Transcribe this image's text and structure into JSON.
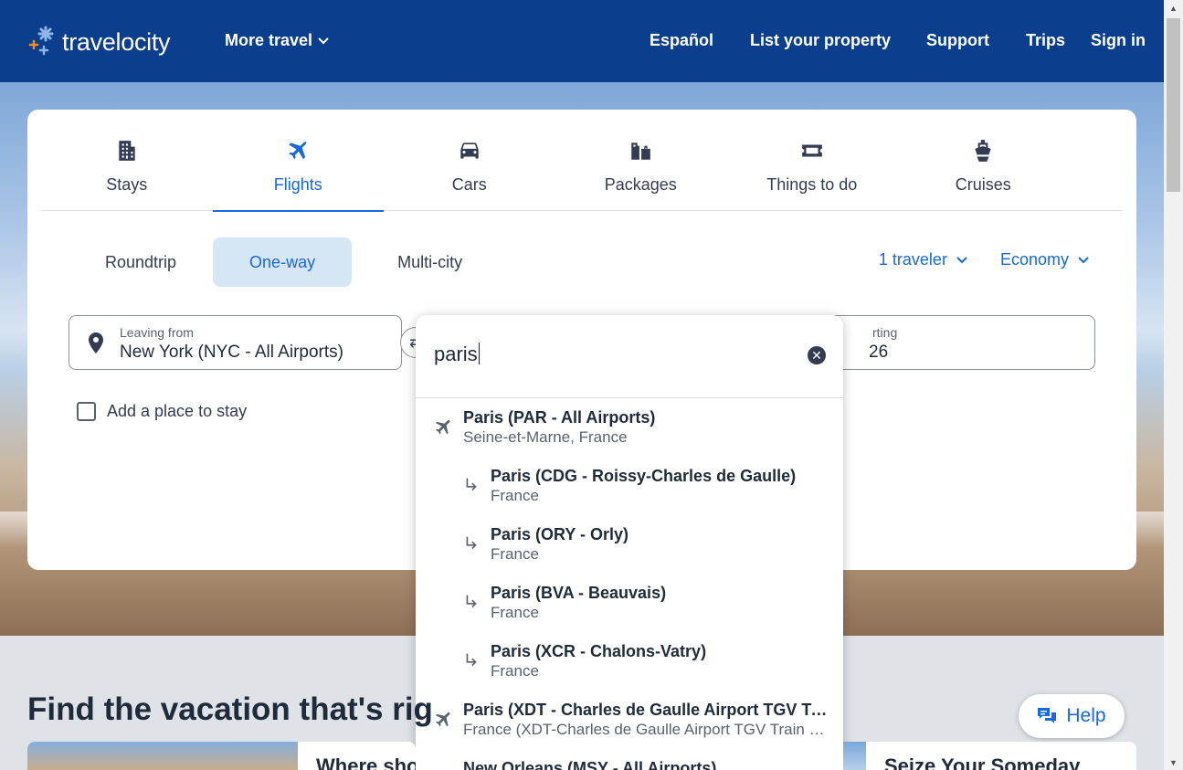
{
  "header": {
    "logo_text": "travelocity",
    "more_travel": "More travel",
    "nav": [
      "Español",
      "List your property",
      "Support",
      "Trips",
      "Sign in"
    ]
  },
  "tabs": [
    {
      "label": "Stays",
      "icon": "building-icon"
    },
    {
      "label": "Flights",
      "icon": "plane-icon",
      "active": true
    },
    {
      "label": "Cars",
      "icon": "car-icon"
    },
    {
      "label": "Packages",
      "icon": "luggage-icon"
    },
    {
      "label": "Things to do",
      "icon": "ticket-icon"
    },
    {
      "label": "Cruises",
      "icon": "ship-icon"
    }
  ],
  "trip_types": [
    "Roundtrip",
    "One-way",
    "Multi-city"
  ],
  "travelers": "1 traveler",
  "cabin": "Economy",
  "leaving_from": {
    "label": "Leaving from",
    "value": "New York (NYC - All Airports)"
  },
  "date_field": {
    "label": "rting",
    "value": "26"
  },
  "add_stay": "Add a place to stay",
  "dropdown": {
    "query": "paris",
    "results": [
      {
        "title": "Paris (PAR - All Airports)",
        "sub": "Seine-et-Marne, France",
        "kind": "main"
      },
      {
        "title": "Paris (CDG - Roissy-Charles de Gaulle)",
        "sub": "France",
        "kind": "sub"
      },
      {
        "title": "Paris (ORY - Orly)",
        "sub": "France",
        "kind": "sub"
      },
      {
        "title": "Paris (BVA - Beauvais)",
        "sub": "France",
        "kind": "sub"
      },
      {
        "title": "Paris (XCR - Chalons-Vatry)",
        "sub": "France",
        "kind": "sub"
      },
      {
        "title": "Paris (XDT - Charles de Gaulle Airport TGV Train Station)",
        "sub": "France (XDT-Charles de Gaulle Airport TGV Train Station)",
        "kind": "main"
      },
      {
        "title": "New Orleans (MSY - All Airports)",
        "sub": "",
        "kind": "main"
      }
    ]
  },
  "find_heading": "Find the vacation that's rig",
  "promo_left": "Where sho",
  "promo_right": "Seize Your Someday",
  "help": "Help",
  "colors": {
    "header": "#0b3f8e",
    "accent": "#1668e3",
    "active_bg": "#d6e6f5"
  }
}
